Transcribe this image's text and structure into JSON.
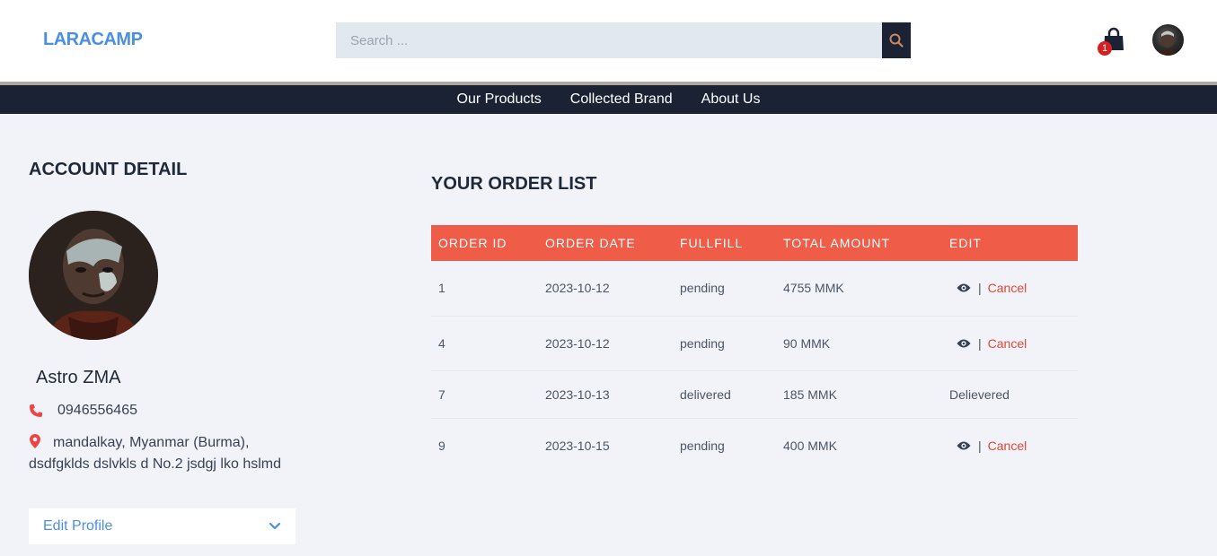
{
  "header": {
    "logo": "LARACAMP",
    "search_placeholder": "Search ...",
    "cart_count": "1"
  },
  "nav": {
    "items": [
      "Our Products",
      "Collected Brand",
      "About Us"
    ]
  },
  "account": {
    "title": "ACCOUNT DETAIL",
    "name": "Astro ZMA",
    "phone": "0946556465",
    "address": "mandalkay, Myanmar (Burma), dsdfgklds dslvkls d No.2 jsdgj lko hslmd",
    "edit_label": "Edit Profile"
  },
  "orders": {
    "title": "YOUR ORDER LIST",
    "columns": [
      "ORDER ID",
      "ORDER DATE",
      "FULLFILL",
      "TOTAL AMOUNT",
      "EDIT"
    ],
    "rows": [
      {
        "id": "1",
        "date": "2023-10-12",
        "status": "pending",
        "amount": "4755 MMK",
        "sep": "|",
        "action": "Cancel"
      },
      {
        "id": "4",
        "date": "2023-10-12",
        "status": "pending",
        "amount": "90 MMK",
        "sep": "|",
        "action": "Cancel"
      },
      {
        "id": "7",
        "date": "2023-10-13",
        "status": "delivered",
        "amount": "185 MMK",
        "action": "Delievered"
      },
      {
        "id": "9",
        "date": "2023-10-15",
        "status": "pending",
        "amount": "400 MMK",
        "sep": "|",
        "action": "Cancel"
      }
    ]
  },
  "colors": {
    "accent_red": "#ef5c48",
    "navy": "#1b2233",
    "link_blue": "#4a90e2",
    "success_green": "#2eb84f"
  },
  "icons": {
    "search": "search-icon",
    "cart": "shopping-bag-icon",
    "phone": "phone-icon",
    "location": "map-pin-icon",
    "view": "eye-icon",
    "dropdown": "chevron-down-icon"
  }
}
